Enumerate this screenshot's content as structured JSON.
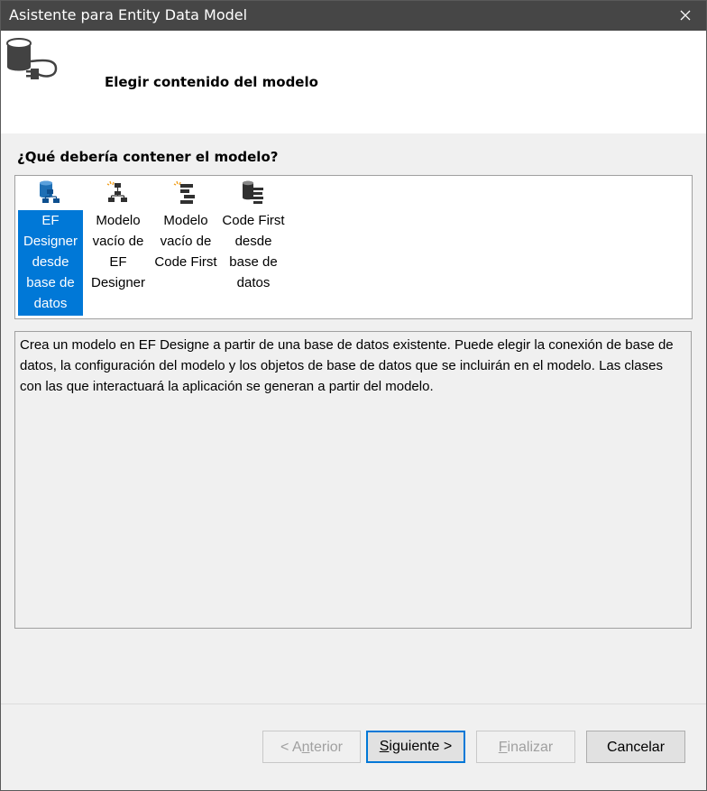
{
  "window": {
    "title": "Asistente para Entity Data Model"
  },
  "header": {
    "title": "Elegir contenido del modelo"
  },
  "question": "¿Qué debería contener el modelo?",
  "items": [
    {
      "label": "EF Designer desde base de datos",
      "icon": "database-designer-icon",
      "selected": true
    },
    {
      "label": "Modelo vacío de EF Designer",
      "icon": "empty-ef-designer-icon",
      "selected": false
    },
    {
      "label": "Modelo vacío de Code First",
      "icon": "empty-code-first-icon",
      "selected": false
    },
    {
      "label": "Code First desde base de datos",
      "icon": "code-first-from-database-icon",
      "selected": false
    }
  ],
  "description": "Crea un modelo en EF Designe a partir de una base de datos existente. Puede elegir la conexión de base de datos, la configuración del modelo y los objetos de base de datos que se incluirán en el modelo. Las clases con las que interactuará la aplicación se generan a partir del modelo.",
  "buttons": {
    "back": {
      "pre": "< A",
      "u": "n",
      "post": "terior"
    },
    "next": {
      "pre": "",
      "u": "S",
      "post": "iguiente >"
    },
    "finish": {
      "pre": "",
      "u": "F",
      "post": "inalizar"
    },
    "cancel": "Cancelar"
  },
  "colors": {
    "selection": "#0078d7",
    "titlebar": "#464646"
  }
}
